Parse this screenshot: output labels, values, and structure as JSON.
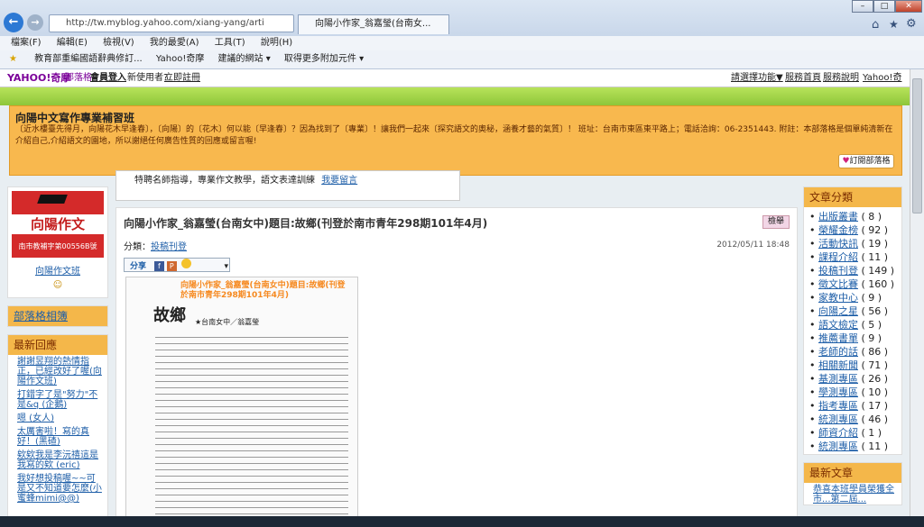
{
  "browser": {
    "url": "http://tw.myblog.yahoo.com/xiang-yang/arti",
    "tab_title": "向陽小作家_翁嘉瑩(台南女...",
    "menu": [
      "檔案(F)",
      "編輯(E)",
      "檢視(V)",
      "我的最愛(A)",
      "工具(T)",
      "說明(H)"
    ],
    "favorites": [
      "教育部重編國語辭典修訂...",
      "Yahoo!奇摩",
      "建議的網站 ▾",
      "取得更多附加元件 ▾"
    ]
  },
  "yahoo_bar": {
    "logo": "YAHOO!奇摩",
    "section": "部落格",
    "login": "會員登入",
    "new_user": "新使用者?",
    "signup": "立即註冊",
    "right_links": [
      "請選擇功能▼",
      "服務首頁",
      "服務說明",
      "Yahoo!奇摩"
    ]
  },
  "header": {
    "title": "向陽中文寫作專業補習班",
    "desc": "〔近水樓臺先得月，向陽花木早逢春〕，〔向陽〕的〔花木〕何以能〔早逢春〕？因為找到了〔專業〕！讓我們一起來〔探究語文的奧秘，涵養才藝的氣質〕！ 班址：台南市東區東平路上；電話洽詢：06-2351443. 附註：本部落格是個單純清新在介紹自己,介紹語文的園地，所以謝絕任何廣告性質的回應或留言喔!",
    "subscribe": "訂閱部落格"
  },
  "tagline": {
    "text": "特聘名師指導，專業作文教學，語文表達訓練",
    "link": "我要留言"
  },
  "left": {
    "logo_title": "向陽作文",
    "logo_sub": "南市教補字第00556B號",
    "profile_name": "向陽作文班",
    "related_title": "部落格相簿",
    "recent_title": "最新回應",
    "recent": [
      "謝謝昱翔的熱情指正，已經改好了喔(向陽作文班)",
      "打錯字了是\"努力\"不是&q (企鵝)",
      "嗯 (女人)",
      "太厲害啦！寫的真好！(黑碴)",
      "欸欸我是李沅禧這是我寫的欸 (eric)",
      "我好想投稿喔~~可是又不知道要怎麼(小蜜蜂mimi@@)"
    ]
  },
  "article": {
    "title": "向陽小作家_翁嘉瑩(台南女中)題目:故鄉(刊登於南市青年298期101年4月)",
    "report": "檢舉",
    "category_label": "分類：",
    "category": "投稿刊登",
    "date": "2012/05/11 18:48",
    "share": "分享",
    "scan_heading": "向陽小作家_翁嘉瑩(台南女中)題目:故鄉(刊登於南市青年298期101年4月)",
    "scan_title": "故鄉",
    "scan_author": "★台南女中／翁嘉瑩"
  },
  "right": {
    "cat_title": "文章分類",
    "categories": [
      {
        "name": "出版叢書",
        "count": "( 8 )"
      },
      {
        "name": "榮耀金榜",
        "count": "( 92 )"
      },
      {
        "name": "活動快訊",
        "count": "( 19 )"
      },
      {
        "name": "課程介紹",
        "count": "( 11 )"
      },
      {
        "name": "投稿刊登",
        "count": "( 149 )"
      },
      {
        "name": "徵文比賽",
        "count": "( 160 )"
      },
      {
        "name": "家教中心",
        "count": "( 9 )"
      },
      {
        "name": "向陽之星",
        "count": "( 56 )"
      },
      {
        "name": "語文檢定",
        "count": "( 5 )"
      },
      {
        "name": "推薦書單",
        "count": "( 9 )"
      },
      {
        "name": "老師的話",
        "count": "( 86 )"
      },
      {
        "name": "相關新聞",
        "count": "( 71 )"
      },
      {
        "name": "基測專區",
        "count": "( 26 )"
      },
      {
        "name": "學測專區",
        "count": "( 10 )"
      },
      {
        "name": "指考專區",
        "count": "( 17 )"
      },
      {
        "name": "統測專區",
        "count": "( 46 )"
      },
      {
        "name": "師資介紹",
        "count": "( 1 )"
      },
      {
        "name": "統測專區",
        "count": "( 11 )"
      }
    ],
    "new_title": "最新文章",
    "new_item": "恭喜本班學員榮獲全市...第二屆..."
  },
  "colors": {
    "accent": "#f4b74a",
    "link": "#1f5fa8",
    "green": "#8ec63a"
  }
}
